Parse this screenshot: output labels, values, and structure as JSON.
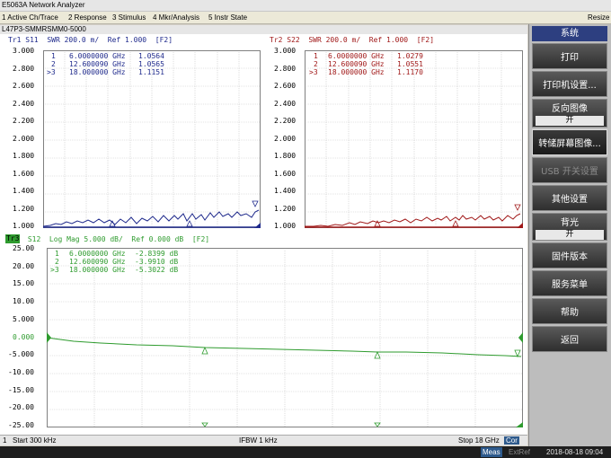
{
  "window": {
    "title": "E5063A Network Analyzer"
  },
  "menu": {
    "items": [
      "1 Active Ch/Trace",
      "2 Response",
      "3 Stimulus",
      "4 Mkr/Analysis",
      "5 Instr State"
    ],
    "resize": "Resize"
  },
  "instrument": {
    "name": "L47P3-SMMRSMM0-5000"
  },
  "softkeys": {
    "title": "系统",
    "print": "打印",
    "printer_setup": "打印机设置...",
    "invert_image": "反向图像",
    "invert_image_state": "开",
    "save_screen": "转储屏幕图像...",
    "usb_switch": "USB 开关设置",
    "misc_setup": "其他设置",
    "backlight": "背光",
    "backlight_state": "开",
    "firmware": "固件版本",
    "service_menu": "服务菜单",
    "help": "帮助",
    "return": "返回"
  },
  "status": {
    "channel": "1",
    "start": "Start 300 kHz",
    "ifbw": "IFBW 1 kHz",
    "stop": "Stop 18 GHz",
    "cor": "Cor"
  },
  "bottom": {
    "meas": "Meas",
    "extref": "ExtRef",
    "datetime": "2018-08-18 09:04"
  },
  "colors": {
    "tr1": "#1f2a8c",
    "tr2": "#a01818",
    "tr3": "#2e9b2e"
  },
  "traces": {
    "tr1": {
      "header": "Tr1 S11  SWR 200.0 m/  Ref 1.000  [F2]",
      "y_ticks": [
        "3.000",
        "2.800",
        "2.600",
        "2.400",
        "2.200",
        "2.000",
        "1.800",
        "1.600",
        "1.400",
        "1.200",
        "1.000"
      ],
      "markers": [
        {
          "id": "1",
          "freq": "6.0000000 GHz",
          "value": "1.0564"
        },
        {
          "id": "2",
          "freq": "12.600090 GHz",
          "value": "1.0565"
        },
        {
          "id": ">3",
          "freq": "18.000000 GHz",
          "value": "1.1151"
        }
      ]
    },
    "tr2": {
      "header": "Tr2 S22  SWR 200.0 m/  Ref 1.000  [F2]",
      "y_ticks": [
        "3.000",
        "2.800",
        "2.600",
        "2.400",
        "2.200",
        "2.000",
        "1.800",
        "1.600",
        "1.400",
        "1.200",
        "1.000"
      ],
      "markers": [
        {
          "id": "1",
          "freq": "6.0000000 GHz",
          "value": "1.0279"
        },
        {
          "id": "2",
          "freq": "12.600090 GHz",
          "value": "1.0551"
        },
        {
          "id": ">3",
          "freq": "18.000000 GHz",
          "value": "1.1170"
        }
      ]
    },
    "tr3": {
      "label": "Tr3",
      "header": " S12  Log Mag 5.000 dB/  Ref 0.000 dB  [F2]",
      "y_ticks": [
        "25.00",
        "20.00",
        "15.00",
        "10.00",
        "5.000",
        "0.000",
        "-5.000",
        "-10.00",
        "-15.00",
        "-20.00",
        "-25.00"
      ],
      "markers": [
        {
          "id": "1",
          "freq": "6.0000000 GHz",
          "value": "-2.8399 dB"
        },
        {
          "id": "2",
          "freq": "12.600090 GHz",
          "value": "-3.9910 dB"
        },
        {
          "id": ">3",
          "freq": "18.000000 GHz",
          "value": "-5.3022 dB"
        }
      ]
    }
  }
}
